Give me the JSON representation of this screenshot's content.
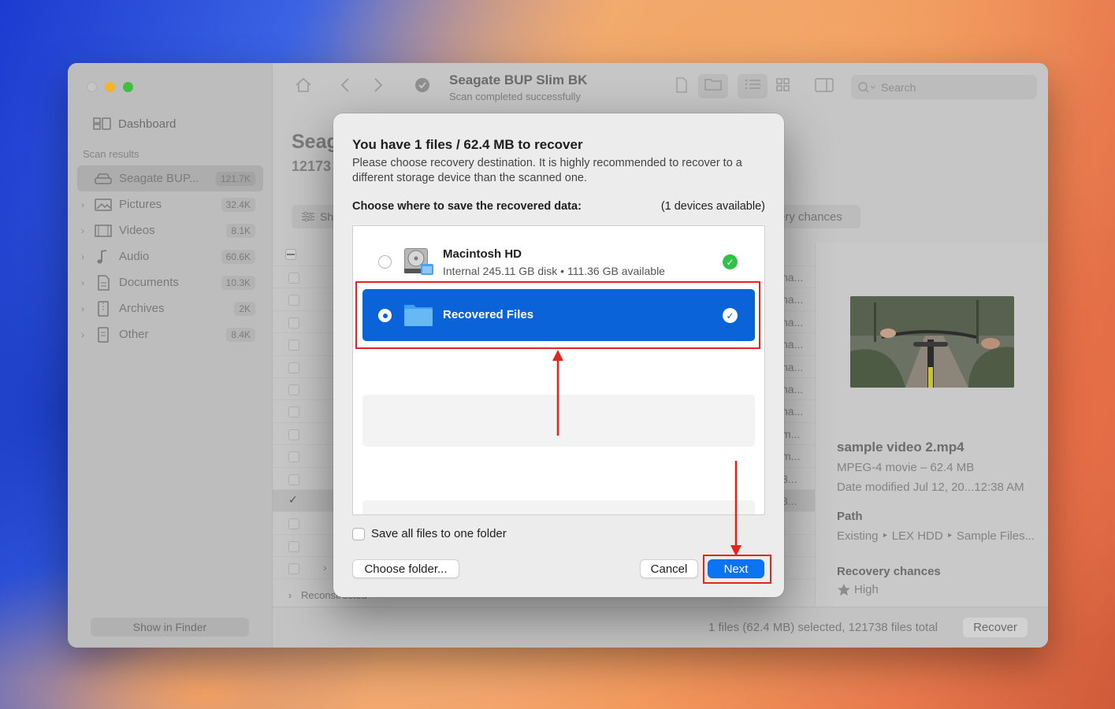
{
  "window": {
    "title": "Seagate BUP Slim BK",
    "subtitle": "Scan completed successfully",
    "search_placeholder": "Search"
  },
  "sidebar": {
    "dashboard_label": "Dashboard",
    "section_label": "Scan results",
    "items": [
      {
        "label": "Seagate BUP...",
        "count": "121.7K",
        "icon": "drive-icon"
      },
      {
        "label": "Pictures",
        "count": "32.4K",
        "icon": "pictures-icon"
      },
      {
        "label": "Videos",
        "count": "8.1K",
        "icon": "video-icon"
      },
      {
        "label": "Audio",
        "count": "60.6K",
        "icon": "music-note-icon"
      },
      {
        "label": "Documents",
        "count": "10.3K",
        "icon": "document-icon"
      },
      {
        "label": "Archives",
        "count": "2K",
        "icon": "archive-icon"
      },
      {
        "label": "Other",
        "count": "8.4K",
        "icon": "other-file-icon"
      }
    ],
    "show_in_finder": "Show in Finder"
  },
  "background": {
    "heading": "Seag",
    "subheading": "12173",
    "show_button": "Sh",
    "recovery_chances_button": "ery chances",
    "row_tails": [
      "na...",
      "na...",
      "na...",
      "na...",
      "na...",
      "na...",
      "na...",
      "m...",
      "m...",
      "3...",
      "3...",
      "",
      "",
      ""
    ],
    "reconstructed": "Reconstructed"
  },
  "preview": {
    "filename": "sample video 2.mp4",
    "type_size": "MPEG-4 movie – 62.4 MB",
    "date_modified": "Date modified  Jul 12, 20...12:38 AM",
    "path_label": "Path",
    "path_value": "Existing ‣ LEX HDD ‣ Sample Files...",
    "recovery_label": "Recovery chances",
    "recovery_value": "High"
  },
  "status": {
    "summary": "1 files (62.4 MB) selected, 121738 files total",
    "recover_button": "Recover"
  },
  "dialog": {
    "title": "You have 1 files / 62.4 MB to recover",
    "description": "Please choose recovery destination. It is highly recommended to recover to a different storage device than the scanned one.",
    "choose_label": "Choose where to save the recovered data:",
    "devices_available": "(1 devices available)",
    "destinations": [
      {
        "name": "Macintosh HD",
        "info": "Internal 245.11 GB disk • 111.36 GB available",
        "selected": false
      },
      {
        "name": "Recovered Files",
        "info": "",
        "selected": true
      }
    ],
    "save_all_label": "Save all files to one folder",
    "choose_folder_button": "Choose folder...",
    "cancel_button": "Cancel",
    "next_button": "Next"
  },
  "colors": {
    "accent": "#0a63d9",
    "next_button": "#0b74f2",
    "annotation": "#e3261b",
    "check_green": "#30c248"
  }
}
